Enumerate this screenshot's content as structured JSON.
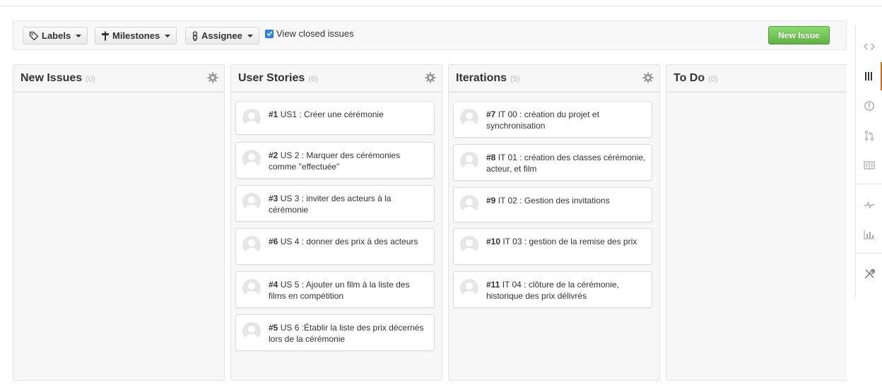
{
  "toolbar": {
    "labels_label": "Labels",
    "milestones_label": "Milestones",
    "assignee_label": "Assignee",
    "view_closed_label": "View closed issues",
    "view_closed_checked": true,
    "new_issue_label": "New Issue"
  },
  "columns": [
    {
      "title": "New Issues",
      "count": "(0)",
      "cards": []
    },
    {
      "title": "User Stories",
      "count": "(6)",
      "cards": [
        {
          "number": "#1",
          "text": "US1 : Créer une cérémonie"
        },
        {
          "number": "#2",
          "text": "US 2 : Marquer des cérémonies comme \"effectuée\""
        },
        {
          "number": "#3",
          "text": "US 3 : inviter des acteurs à la cérémonie"
        },
        {
          "number": "#6",
          "text": "US 4 : donner des prix à des acteurs"
        },
        {
          "number": "#4",
          "text": "US 5 : Ajouter un film à la liste des films en compétition"
        },
        {
          "number": "#5",
          "text": "US 6 :Établir la liste des prix décernés lors de la cérémonie"
        }
      ]
    },
    {
      "title": "Iterations",
      "count": "(5)",
      "cards": [
        {
          "number": "#7",
          "text": "IT 00 : création du projet et synchronisation"
        },
        {
          "number": "#8",
          "text": "IT 01 : création des classes cérémonie, acteur, et film"
        },
        {
          "number": "#9",
          "text": "IT 02 : Gestion des invitations"
        },
        {
          "number": "#10",
          "text": "IT 03 : gestion de la remise des prix"
        },
        {
          "number": "#11",
          "text": "IT 04 : clôture de la cérémonie, historique des prix délivrés"
        }
      ]
    },
    {
      "title": "To Do",
      "count": "(0)",
      "cards": []
    }
  ],
  "sidebar": {
    "items": [
      "code-icon",
      "board-icon",
      "issues-icon",
      "pull-request-icon",
      "wiki-icon",
      "pulse-icon",
      "graphs-icon",
      "settings-icon"
    ],
    "active": "board-icon"
  },
  "colors": {
    "accent_green": "#60b044",
    "active_tab": "#d26911",
    "checkbox": "#2f86e6"
  }
}
